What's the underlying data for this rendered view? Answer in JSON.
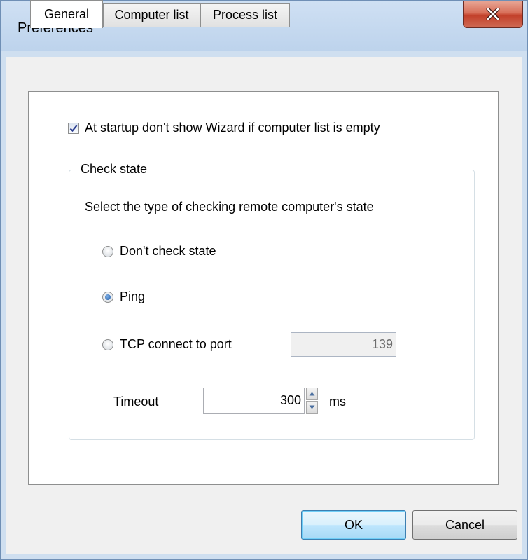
{
  "window": {
    "title": "Preferences"
  },
  "tabs": [
    {
      "label": "General",
      "active": true
    },
    {
      "label": "Computer list",
      "active": false
    },
    {
      "label": "Process list",
      "active": false
    }
  ],
  "general": {
    "startup_checkbox": {
      "label": "At startup don't show Wizard if computer list is empty",
      "checked": true
    },
    "check_state": {
      "group_label": "Check state",
      "description": "Select the type  of  checking remote computer's state",
      "options": [
        {
          "label": "Don't check state",
          "selected": false
        },
        {
          "label": "Ping",
          "selected": true
        },
        {
          "label": "TCP connect to port",
          "selected": false
        }
      ],
      "port_value": "139",
      "timeout_label": "Timeout",
      "timeout_value": "300",
      "timeout_unit": "ms"
    }
  },
  "buttons": {
    "ok": "OK",
    "cancel": "Cancel"
  },
  "colors": {
    "accent": "#1d58a4",
    "close_button": "#c2402a",
    "frame": "#bdd3ec"
  }
}
